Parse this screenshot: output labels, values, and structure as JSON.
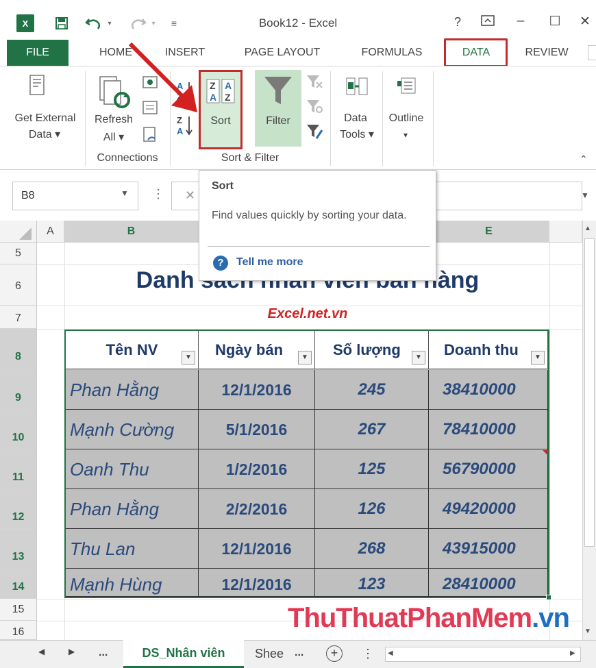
{
  "window": {
    "title": "Book12 - Excel",
    "help": "?",
    "logo": "X"
  },
  "tabs": {
    "file": "FILE",
    "home": "HOME",
    "insert": "INSERT",
    "page_layout": "PAGE LAYOUT",
    "formulas": "FORMULAS",
    "data": "DATA",
    "review": "REVIEW"
  },
  "ribbon": {
    "get_external_line1": "Get External",
    "get_external_line2": "Data",
    "refresh_line1": "Refresh",
    "refresh_line2": "All",
    "connections_group": "Connections",
    "sort": "Sort",
    "filter": "Filter",
    "sort_filter_group": "Sort & Filter",
    "data_tools_line1": "Data",
    "data_tools_line2": "Tools",
    "outline": "Outline"
  },
  "tooltip": {
    "title": "Sort",
    "description": "Find values quickly by sorting your data.",
    "help_link": "Tell me more"
  },
  "formula_bar": {
    "name_box": "B8"
  },
  "columns": [
    "A",
    "B",
    "E"
  ],
  "rows": [
    "5",
    "6",
    "7",
    "8",
    "9",
    "10",
    "11",
    "12",
    "13",
    "14",
    "15",
    "16"
  ],
  "sheet": {
    "title": "Danh sách nhân viên bán hàng",
    "subtitle": "Excel.net.vn",
    "headers": [
      "Tên NV",
      "Ngày bán",
      "Số lượng",
      "Doanh thu"
    ],
    "records": [
      [
        "Phan Hằng",
        "12/1/2016",
        "245",
        "38410000"
      ],
      [
        "Mạnh Cường",
        "5/1/2016",
        "267",
        "78410000"
      ],
      [
        "Oanh Thu",
        "1/2/2016",
        "125",
        "56790000"
      ],
      [
        "Phan Hằng",
        "2/2/2016",
        "126",
        "49420000"
      ],
      [
        "Thu Lan",
        "12/1/2016",
        "268",
        "43915000"
      ],
      [
        "Mạnh Hùng",
        "12/1/2016",
        "123",
        "28410000"
      ]
    ]
  },
  "sheet_tabs": {
    "ellipsis": "...",
    "active": "DS_Nhân viên",
    "next": "Shee",
    "next_ellipsis": "..."
  },
  "watermark": {
    "main": "ThuThuatPhanMem",
    "tail": ".vn"
  },
  "colors": {
    "excel_green": "#217346",
    "highlight_red": "#c42b2b",
    "title_blue": "#1f3a68"
  }
}
